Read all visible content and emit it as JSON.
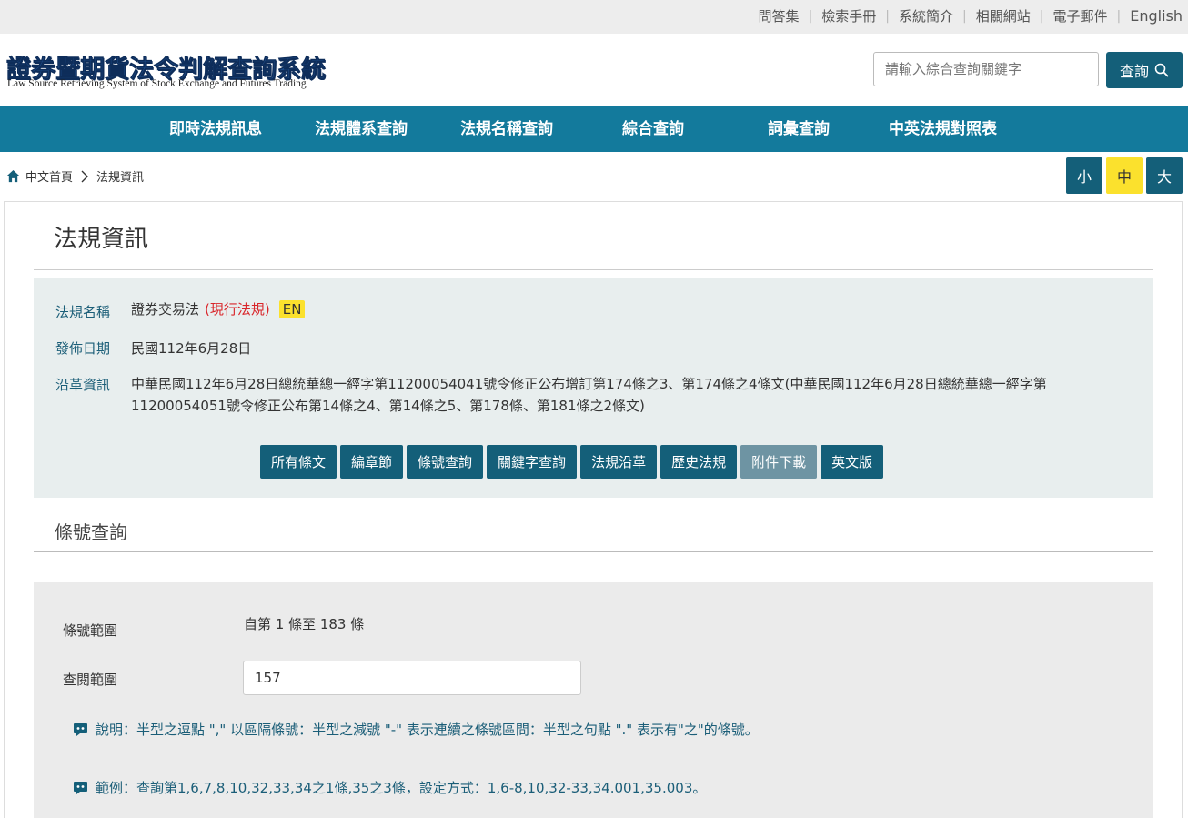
{
  "top_links": [
    "問答集",
    "檢索手冊",
    "系統簡介",
    "相關網站",
    "電子郵件",
    "English"
  ],
  "site": {
    "title": "證券暨期貨法令判解查詢系統",
    "subtitle": "Law Source Retrieving System of Stock Exchange and Futures Trading"
  },
  "search": {
    "placeholder": "請輸入綜合查詢關鍵字",
    "button_label": "查詢"
  },
  "nav": [
    "即時法規訊息",
    "法規體系查詢",
    "法規名稱查詢",
    "綜合查詢",
    "詞彙查詢",
    "中英法規對照表"
  ],
  "breadcrumb": {
    "home": "中文首頁",
    "current": "法規資訊"
  },
  "font_size": {
    "small": "小",
    "medium": "中",
    "large": "大",
    "selected": "中"
  },
  "page_title": "法規資訊",
  "law_info": {
    "name_label": "法規名稱",
    "name": "證券交易法",
    "status": "(現行法規)",
    "en_badge": "EN",
    "date_label": "發佈日期",
    "date": "民國112年6月28日",
    "history_label": "沿革資訊",
    "history": "中華民國112年6月28日總統華總一經字第11200054041號令修正公布增訂第174條之3、第174條之4條文(中華民國112年6月28日總統華總一經字第11200054051號令修正公布第14條之4、第14條之5、第178條、第181條之2條文)"
  },
  "action_buttons": [
    "所有條文",
    "編章節",
    "條號查詢",
    "關鍵字查詢",
    "法規沿革",
    "歷史法規",
    "附件下載",
    "英文版"
  ],
  "action_disabled": "附件下載",
  "article_query": {
    "section_title": "條號查詢",
    "range_label": "條號範圍",
    "range_value": "自第 1 條至 183 條",
    "query_label": "查閱範圍",
    "query_value": "157",
    "note": "說明：半型之逗點 \",\" 以區隔條號：半型之減號 \"-\" 表示連續之條號區間：半型之句點 \".\" 表示有\"之\"的條號。",
    "example": "範例：查詢第1,6,7,8,10,32,33,34之1條,35之3條，設定方式：1,6-8,10,32-33,34.001,35.003。"
  },
  "colors": {
    "nav_bg": "#137a9c",
    "button_bg": "#145f79",
    "highlight_yellow": "#fbe12d",
    "status_red": "#d9252a"
  }
}
